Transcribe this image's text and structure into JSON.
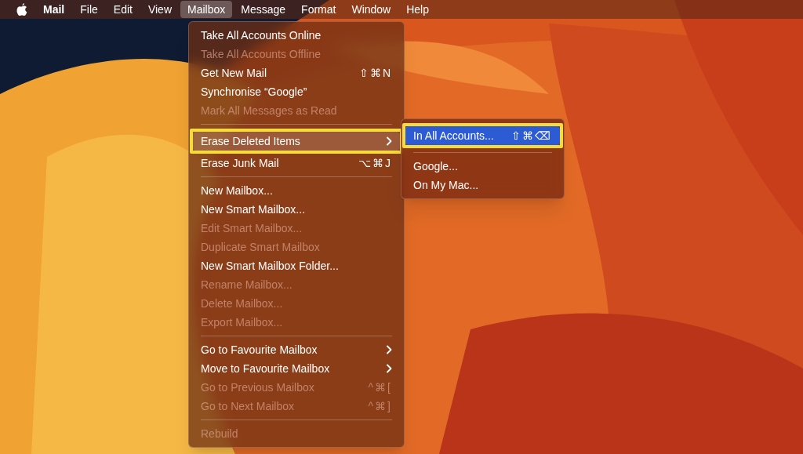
{
  "menubar": [
    {
      "kind": "apple"
    },
    {
      "kind": "app",
      "label": "Mail",
      "selected": false
    },
    {
      "kind": "menu",
      "label": "File",
      "selected": false
    },
    {
      "kind": "menu",
      "label": "Edit",
      "selected": false
    },
    {
      "kind": "menu",
      "label": "View",
      "selected": false
    },
    {
      "kind": "menu",
      "label": "Mailbox",
      "selected": true
    },
    {
      "kind": "menu",
      "label": "Message",
      "selected": false
    },
    {
      "kind": "menu",
      "label": "Format",
      "selected": false
    },
    {
      "kind": "menu",
      "label": "Window",
      "selected": false
    },
    {
      "kind": "menu",
      "label": "Help",
      "selected": false
    }
  ],
  "menu": {
    "items": [
      {
        "kind": "item",
        "label": "Take All Accounts Online",
        "disabled": false,
        "selected": false
      },
      {
        "kind": "item",
        "label": "Take All Accounts Offline",
        "disabled": true,
        "selected": false
      },
      {
        "kind": "item",
        "label": "Get New Mail",
        "shortcut": "⇧⌘N",
        "disabled": false,
        "selected": false
      },
      {
        "kind": "item",
        "label": "Synchronise “Google”",
        "disabled": false,
        "selected": false
      },
      {
        "kind": "item",
        "label": "Mark All Messages as Read",
        "disabled": true,
        "selected": false
      },
      {
        "kind": "separator"
      },
      {
        "kind": "item",
        "label": "Erase Deleted Items",
        "submenu": true,
        "disabled": false,
        "selected": true,
        "outlined": true
      },
      {
        "kind": "item",
        "label": "Erase Junk Mail",
        "shortcut": "⌥⌘J",
        "disabled": false,
        "selected": false
      },
      {
        "kind": "separator"
      },
      {
        "kind": "item",
        "label": "New Mailbox...",
        "disabled": false,
        "selected": false
      },
      {
        "kind": "item",
        "label": "New Smart Mailbox...",
        "disabled": false,
        "selected": false
      },
      {
        "kind": "item",
        "label": "Edit Smart Mailbox...",
        "disabled": true,
        "selected": false
      },
      {
        "kind": "item",
        "label": "Duplicate Smart Mailbox",
        "disabled": true,
        "selected": false
      },
      {
        "kind": "item",
        "label": "New Smart Mailbox Folder...",
        "disabled": false,
        "selected": false
      },
      {
        "kind": "item",
        "label": "Rename Mailbox...",
        "disabled": true,
        "selected": false
      },
      {
        "kind": "item",
        "label": "Delete Mailbox...",
        "disabled": true,
        "selected": false
      },
      {
        "kind": "item",
        "label": "Export Mailbox...",
        "disabled": true,
        "selected": false
      },
      {
        "kind": "separator"
      },
      {
        "kind": "item",
        "label": "Go to Favourite Mailbox",
        "submenu": true,
        "disabled": false,
        "selected": false
      },
      {
        "kind": "item",
        "label": "Move to Favourite Mailbox",
        "submenu": true,
        "disabled": false,
        "selected": false
      },
      {
        "kind": "item",
        "label": "Go to Previous Mailbox",
        "shortcut": "^⌘[",
        "disabled": true,
        "selected": false
      },
      {
        "kind": "item",
        "label": "Go to Next Mailbox",
        "shortcut": "^⌘]",
        "disabled": true,
        "selected": false
      },
      {
        "kind": "separator"
      },
      {
        "kind": "item",
        "label": "Rebuild",
        "disabled": true,
        "selected": false
      }
    ]
  },
  "submenu": {
    "items": [
      {
        "kind": "item",
        "label": "In All Accounts...",
        "shortcut": "⇧⌘⌫",
        "disabled": false,
        "selected": true,
        "outlined": true
      },
      {
        "kind": "separator"
      },
      {
        "kind": "item",
        "label": "Google...",
        "disabled": false,
        "selected": false
      },
      {
        "kind": "item",
        "label": "On My Mac...",
        "disabled": false,
        "selected": false
      }
    ]
  }
}
